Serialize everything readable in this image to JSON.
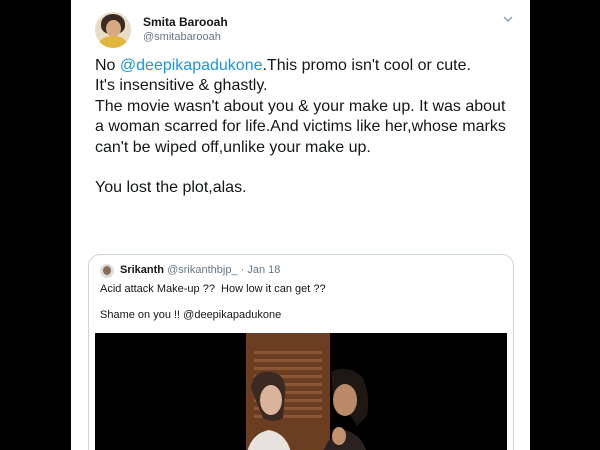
{
  "tweet": {
    "display_name": "Smita Barooah",
    "handle": "@smitabarooah",
    "text_prefix": "No ",
    "mention": "@deepikapadukone",
    "text_body": ".This promo isn't cool or cute.\nIt's insensitive & ghastly.\nThe movie wasn't about you & your make up. It was about a woman scarred for life.And victims like her,whose marks can't be wiped off,unlike your make up.\n\nYou lost the plot,alas.",
    "menu_icon": "chevron-down-icon"
  },
  "quoted": {
    "display_name": "Srikanth",
    "meta": "@srikanthbjp_ · Jan 18",
    "line1": "Acid attack Make-up ??  How low it can get ??",
    "line2": "Shame on you !! @deepikapadukone"
  },
  "colors": {
    "mention": "#1b95e0",
    "text": "#14171a",
    "muted": "#657786",
    "border": "#ccd6dd"
  }
}
